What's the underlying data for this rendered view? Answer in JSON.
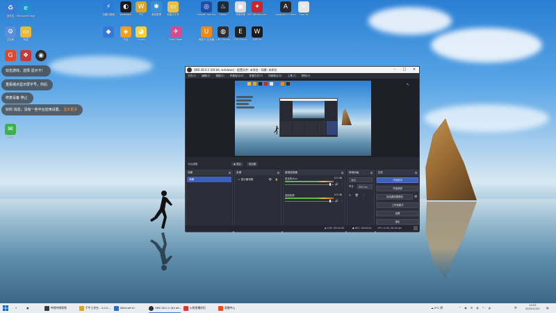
{
  "desktop": {
    "icons_row1": [
      {
        "label": "回收站",
        "color": "#3a7bd5",
        "glyph": "♻"
      },
      {
        "label": "Microsoft Edge",
        "color": "#1e8fcf",
        "glyph": "e"
      }
    ],
    "icons_left": [
      {
        "label": "控制面",
        "color": "#5b8fd9",
        "glyph": "⚙"
      },
      {
        "label": "新建",
        "color": "#e8b93a",
        "glyph": "▭"
      },
      {
        "label": "",
        "color": "#d94a2f",
        "glyph": "G"
      },
      {
        "label": "",
        "color": "#c23a3a",
        "glyph": "❖"
      },
      {
        "label": "",
        "color": "#2b2b2b",
        "glyph": "◉"
      },
      {
        "label": "微信",
        "color": "#3bb34a",
        "glyph": "✉"
      }
    ],
    "icons_top": [
      {
        "label": "迅雷加速器",
        "color": "#2b7bd9",
        "glyph": "⚡"
      },
      {
        "label": "Wallpaper",
        "color": "#1a1a1a",
        "glyph": "◐"
      },
      {
        "label": "千牛",
        "color": "#d8a62a",
        "glyph": "W"
      },
      {
        "label": "桌面整理",
        "color": "#3a8fd0",
        "glyph": "✱"
      },
      {
        "label": "新建文件夹",
        "color": "#e9c046",
        "glyph": "▭"
      },
      {
        "label": "Ubisoft Connect",
        "color": "#1e4fa8",
        "glyph": "◎"
      },
      {
        "label": "Steam",
        "color": "#1b2838",
        "glyph": "♨"
      },
      {
        "label": "哔哩哔哩",
        "color": "#d9d9d9",
        "glyph": "▣"
      },
      {
        "label": "MSI Afterburner",
        "color": "#c8262c",
        "glyph": "✦"
      },
      {
        "label": "Assassin's Creed",
        "color": "#2a2a2a",
        "glyph": "A"
      },
      {
        "label": "CapCut",
        "color": "#e5e5e5",
        "glyph": "✂"
      }
    ],
    "icons_top2": [
      {
        "label": "",
        "color": "#3478d8",
        "glyph": "◆"
      },
      {
        "label": "奇游",
        "color": "#f0a020",
        "glyph": "◈"
      },
      {
        "label": "Oracle",
        "color": "#f2d23a",
        "glyph": "◕"
      },
      {
        "label": "Beat Saber",
        "color": "#d54b8f",
        "glyph": "✈"
      },
      {
        "label": "网易UU加速器",
        "color": "#ef8a1a",
        "glyph": "U"
      },
      {
        "label": "OBS Studio",
        "color": "#303030",
        "glyph": "◍"
      },
      {
        "label": "EVE Online",
        "color": "#222",
        "glyph": "E"
      },
      {
        "label": "MWFire",
        "color": "#1a1a1a",
        "glyph": "W"
      }
    ],
    "chats": [
      {
        "text": "双击游戏，选择 显示卡！"
      },
      {
        "text": "重看端点显示屏字号，你后"
      },
      {
        "text": "修复设备 停止"
      },
      {
        "text": "好的 消息，没有一些平台应用设置，",
        "highlight": "显示更多"
      }
    ]
  },
  "obs": {
    "title": "OBS 28.0.1 (64 bit, windows) - 配置文件: 未命名 - 场景: 未命名",
    "menu": [
      "文件(F)",
      "编辑(E)",
      "视图(V)",
      "停靠窗口(D)",
      "配置文件(P)",
      "场景集合(S)",
      "工具(T)",
      "帮助(H)"
    ],
    "preview_ctl": {
      "label": "今后调整",
      "btn1": "混合",
      "btn2": "前后置"
    },
    "docks": {
      "scenes": {
        "title": "场景",
        "items": [
          "场景"
        ]
      },
      "sources": {
        "title": "来源",
        "items": [
          "显示器采集"
        ]
      },
      "mixer": {
        "title": "音频混音器",
        "channels": [
          {
            "name": "麦克风/Aux",
            "db": "0.0 dB"
          },
          {
            "name": "桌面音频",
            "db": "0.0 dB"
          }
        ]
      },
      "transitions": {
        "title": "转场动画",
        "type": "淡出",
        "duration_label": "时长",
        "duration": "300 ms"
      },
      "controls": {
        "title": "控件",
        "buttons": [
          "开始推流",
          "开始录制",
          "启动虚拟摄像机",
          "工作室模式",
          "设置",
          "退出"
        ]
      }
    },
    "status": {
      "live": "LIVE: 00:00:00",
      "rec": "REC: 00:00:00",
      "cpu": "CPU: 0.4%, 60.00 fps"
    }
  },
  "taskbar": {
    "items": [
      {
        "label": "",
        "color": "#0a66c2"
      },
      {
        "label": "搜索",
        "color": "#444"
      },
      {
        "label": "哔哩哔哩视频",
        "color": "#3a3a3a"
      },
      {
        "label": "千牛工作台 - 2.0.0...",
        "color": "#d8a62a"
      },
      {
        "label": "Warcraft III",
        "color": "#2c6fb7"
      },
      {
        "label": "OBS 28.0.1 (64 bit...",
        "color": "#303030"
      },
      {
        "label": "火柴直播伴侣",
        "color": "#d83a3a"
      },
      {
        "label": "直播中心",
        "color": "#e45020"
      }
    ],
    "weather": "0°C 阴",
    "lang": "中",
    "time": "10:53",
    "date": "2022/11/22"
  }
}
